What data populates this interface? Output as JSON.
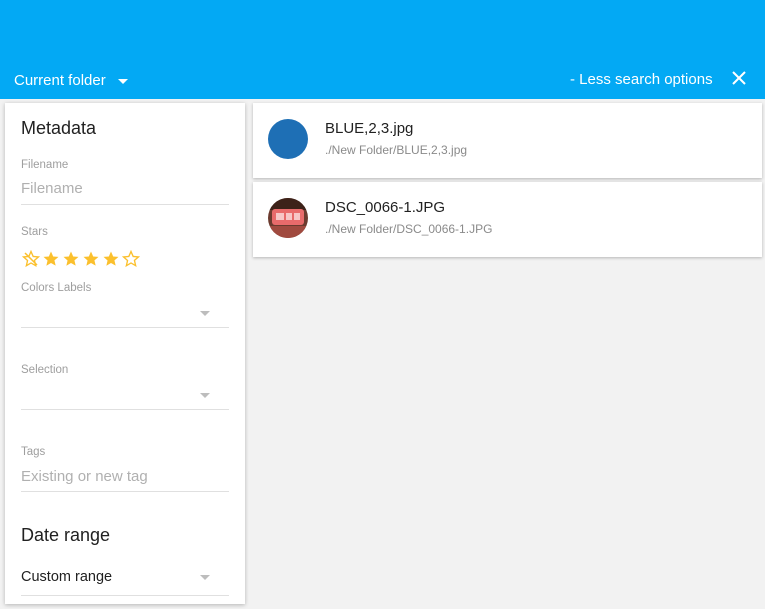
{
  "header": {
    "folder_label": "Current folder",
    "less_options": "- Less search options",
    "close_icon": "close-icon",
    "bg_color": "#03a9f4"
  },
  "panel": {
    "metadata_title": "Metadata",
    "filename": {
      "label": "Filename",
      "placeholder": "Filename"
    },
    "stars": {
      "label": "Stars",
      "icons": [
        "no-rating-icon",
        "star-filled-icon",
        "star-filled-icon",
        "star-filled-icon",
        "star-filled-icon",
        "star-outline-icon"
      ],
      "color": "#fbc02d"
    },
    "colors_labels": {
      "label": "Colors Labels",
      "value": ""
    },
    "selection": {
      "label": "Selection",
      "value": ""
    },
    "tags": {
      "label": "Tags",
      "placeholder": "Existing or new tag"
    },
    "date_range_title": "Date range",
    "date_range": {
      "value": "Custom range"
    }
  },
  "results": [
    {
      "name": "BLUE,2,3.jpg",
      "path": "./New Folder/BLUE,2,3.jpg",
      "thumb": "blue-circle-thumbnail",
      "thumb_color": "#1e6fb5"
    },
    {
      "name": "DSC_0066-1.JPG",
      "path": "./New Folder/DSC_0066-1.JPG",
      "thumb": "photo-thumbnail"
    }
  ]
}
